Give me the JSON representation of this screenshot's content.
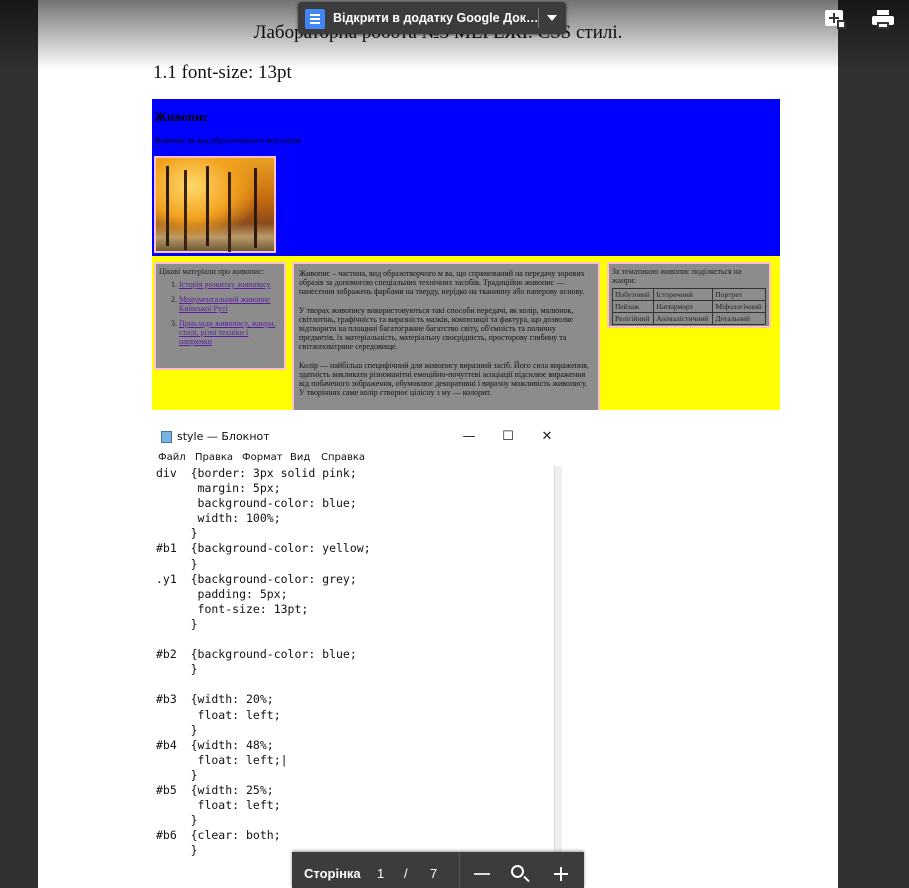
{
  "toolbar": {
    "open_button_label": "Відкрити в додатку Google Док…",
    "add_icon": "add-to-drive-icon",
    "print_icon": "print-icon"
  },
  "document": {
    "title": "Лабораторна робота №3 МЕРЕЖІ. CSS стилі.",
    "subtitle": "1.1 font-size: 13pt"
  },
  "rendered_page": {
    "heading": "Живопис",
    "lead": "Живопис як вид образотворчого мистецтва",
    "left_block": {
      "intro": "Цікаві матеріали про живопис:",
      "links": [
        "Історія розвитку живопису",
        "Монументальний живопис Київської Русі",
        "Приклади живопису, жанри, стилі, різні техніки і напрямки"
      ]
    },
    "center_block": {
      "paragraphs": [
        "Живопис – частина, вид образотворчого м ва, що спрямований на передачу зорових образів за допомогою спеціальних технічних засобів. Традиційно живопис — нанесення зображень фарбами на тверду, нерідко на тканинну або паперову основу.",
        "У творах живопису використовуються такі способи передачі, як колір, малюнок, світлотінь, графічність та виразність мазків, композиції та фактура, що дозволяє відтворити на площині багатогранне багатство світу, об'ємність та поличну предметів, їх матеріальність, матеріальну своєрідність, просторову глибину та світлоповітряне середовище.",
        "Колір — найбільш специфічний для живопису виразний засіб. Його сила вираження, здатність викликати різноманітні емоційно-почуттєві асоціації підсилює вираження від побаченого зображення, обумовлює декоративні і виразну можливість живопису. У творіннях саме колір створює цілісну з му — колорит."
      ]
    },
    "right_block": {
      "intro": "За тематикою живопис поділяється на жанри:",
      "table": [
        [
          "Побутовий",
          "Історичний",
          "Портрет"
        ],
        [
          "Пейзаж",
          "Натюрморт",
          "Міфологічний"
        ],
        [
          "Релігійний",
          "Анімалістичний",
          "Детальний"
        ]
      ]
    }
  },
  "notepad": {
    "title": "style — Блокнот",
    "menu": [
      "Файл",
      "Правка",
      "Формат",
      "Вид",
      "Справка"
    ],
    "minimize": "—",
    "maximize": "☐",
    "close": "✕",
    "code": "div  {border: 3px solid pink;\n      margin: 5px;\n      background-color: blue;\n      width: 100%;\n     }\n#b1  {background-color: yellow;\n     }\n.y1  {background-color: grey;\n      padding: 5px;\n      font-size: 13pt;\n     }\n\n#b2  {background-color: blue;\n     }\n\n#b3  {width: 20%;\n      float: left;\n     }\n#b4  {width: 48%;\n      float: left;|\n     }\n#b5  {width: 25%;\n      float: left;\n     }\n#b6  {clear: both;\n     }"
  },
  "pager": {
    "label": "Сторінка",
    "current": "1",
    "separator": "/",
    "total": "7"
  }
}
